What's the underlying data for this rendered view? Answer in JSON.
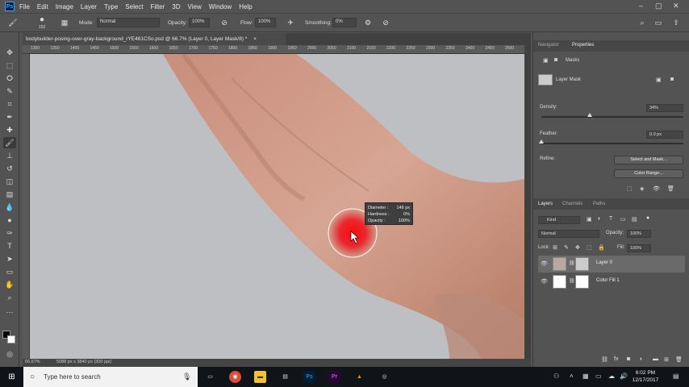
{
  "menubar": {
    "logo": "Ps",
    "items": [
      "File",
      "Edit",
      "Image",
      "Layer",
      "Type",
      "Select",
      "Filter",
      "3D",
      "View",
      "Window",
      "Help"
    ],
    "window_controls": [
      "–",
      "▢",
      "✕"
    ]
  },
  "options_bar": {
    "brush_size": "152",
    "mode_label": "Mode:",
    "mode_value": "Normal",
    "opacity_label": "Opacity:",
    "opacity_value": "100%",
    "flow_label": "Flow:",
    "flow_value": "100%",
    "smoothing_label": "Smoothing:",
    "smoothing_value": "0%"
  },
  "document": {
    "tab_title": "bodybuilder-posing-over-gray-background_rYE461CSo.psd @ 66.7% (Layer 0, Layer Mask/8) *",
    "tab_close": "×",
    "ruler_ticks": [
      "1300",
      "1350",
      "1400",
      "1450",
      "1500",
      "1550",
      "1600",
      "1650",
      "1700",
      "1750",
      "1800",
      "1850",
      "1900",
      "1950",
      "2000",
      "2050",
      "2100",
      "2150",
      "2200",
      "2250",
      "2300",
      "2350",
      "2400",
      "2450",
      "2500"
    ],
    "status_zoom": "66.67%",
    "status_info": "5088 px x 3840 px (300 ppi)"
  },
  "brush_tooltip": {
    "diameter_label": "Diameter :",
    "diameter_value": "146 px",
    "hardness_label": "Hardness :",
    "hardness_value": "0%",
    "opacity_label": "Opacity :",
    "opacity_value": "100%"
  },
  "properties_panel": {
    "tabs": [
      "Navigator",
      "Properties"
    ],
    "masks_label": "Masks",
    "layer_mask_label": "Layer Mask",
    "density_label": "Density:",
    "density_value": "34%",
    "density_level": 0.34,
    "feather_label": "Feather:",
    "feather_value": "0.0 px",
    "refine_label": "Refine:",
    "select_and_mask": "Select and Mask...",
    "color_range": "Color Range..."
  },
  "layers_panel": {
    "tabs": [
      "Layers",
      "Channels",
      "Paths"
    ],
    "kind_label": "Kind",
    "blend_mode": "Normal",
    "opacity_label": "Opacity:",
    "opacity_value": "100%",
    "lock_label": "Lock:",
    "fill_label": "Fill:",
    "fill_value": "100%",
    "layers": [
      {
        "name": "Layer 0",
        "selected": true
      },
      {
        "name": "Color Fill 1",
        "selected": false
      }
    ]
  },
  "taskbar": {
    "search_placeholder": "Type here to search",
    "time": "6:02 PM",
    "date": "12/17/2017"
  },
  "colors": {
    "canvas_bg": "#bdbfc2",
    "skin": "#d9a896",
    "brush_red": "#e8000c",
    "panel_bg": "#535353"
  }
}
